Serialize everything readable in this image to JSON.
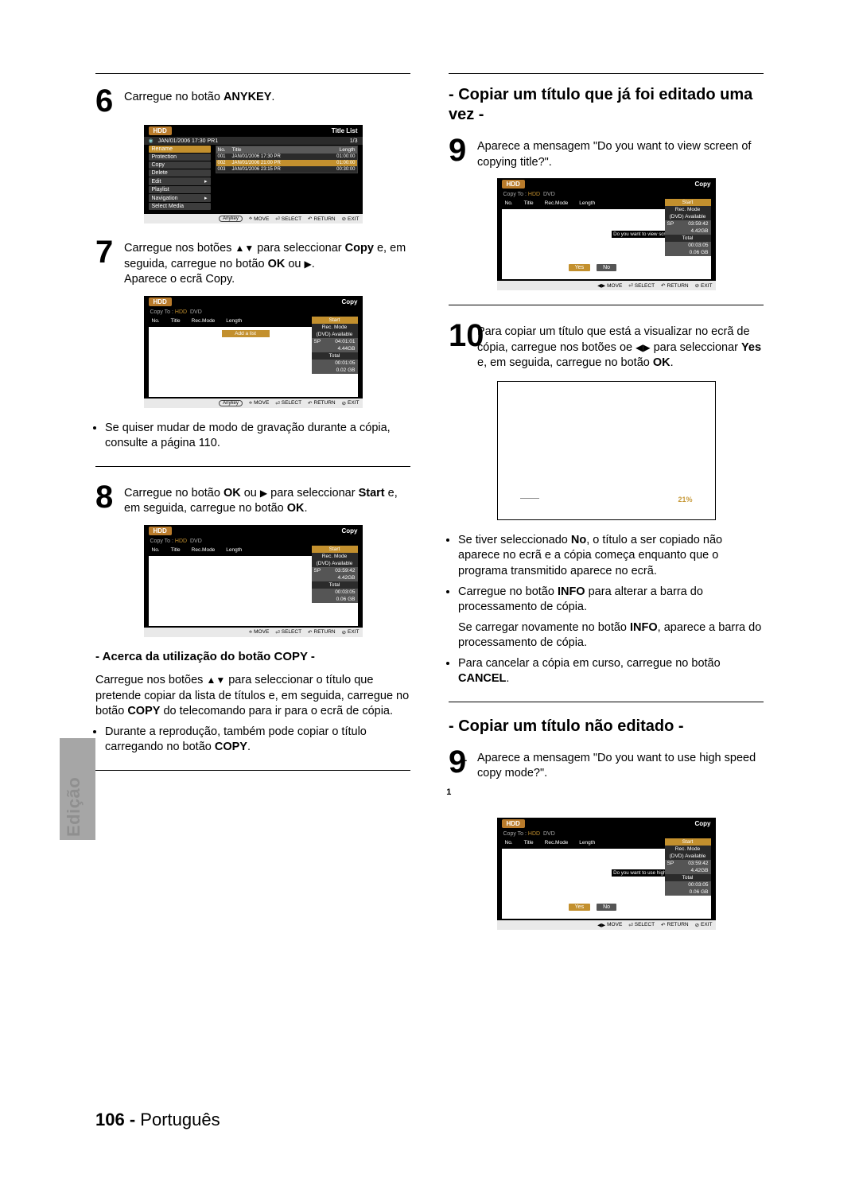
{
  "side_tab_label": "Edição",
  "footer": {
    "page_no": "106 -",
    "lang": "Português"
  },
  "left": {
    "step6": {
      "num": "6",
      "text_a": "Carregue no botão ",
      "text_b_bold": "ANYKEY",
      "text_c": "."
    },
    "step7": {
      "num": "7",
      "line1_a": "Carregue nos botões ",
      "line1_tri": "▲▼",
      "line1_b": " para seleccionar ",
      "line1_bold": "Copy",
      "line2_a": "e, em seguida, carregue no botão ",
      "line2_bold": "OK",
      "line2_b": " ou ",
      "line2_tri": "▶",
      "line2_c": ".",
      "line3": "Aparece o ecrã Copy."
    },
    "bullet_after7": "Se quiser mudar de modo de gravação durante a cópia, consulte a página 110.",
    "step8": {
      "num": "8",
      "line1_a": "Carregue no botão ",
      "line1_bold1": "OK",
      "line1_b": " ou ",
      "line1_tri": "▶",
      "line1_c": " para seleccionar",
      "line2_bold": "Start",
      "line2_a": " e, em seguida, carregue no botão ",
      "line2_bold2": "OK",
      "line2_b": "."
    },
    "sub_heading": "- Acerca da utilização do botão COPY -",
    "copy_para_a": "Carregue nos botões ",
    "copy_para_tri": "▲▼",
    "copy_para_b": " para seleccionar o título que pretende copiar da lista de títulos e, em seguida, carregue no botão ",
    "copy_para_bold": "COPY",
    "copy_para_c": " do telecomando para ir para o ecrã de cópia.",
    "copy_bullet_a": "Durante a reprodução, também pode copiar o título carregando no botão ",
    "copy_bullet_bold": "COPY",
    "copy_bullet_b": "."
  },
  "right": {
    "heading1": "- Copiar um título que já foi editado uma vez -",
    "step9": {
      "num": "9",
      "text": "Aparece a mensagem \"Do you want to view screen of copying title?\"."
    },
    "step10": {
      "num": "10",
      "line1": "Para copiar um título que está a visualizar no ecrã de cópia, carregue nos botões oe ",
      "line1_tri": "◀▶",
      "line1_b": " para seleccionar ",
      "line1_bold": "Yes",
      "line1_c": " e, em seguida, carregue no botão ",
      "line1_bold2": "OK",
      "line1_d": "."
    },
    "bullets_after10": [
      {
        "a": "Se tiver seleccionado ",
        "bold": "No",
        "b": ", o título a ser copiado não aparece no ecrã e a cópia começa enquanto que o programa transmitido aparece no ecrã."
      },
      {
        "a": "Carregue no botão ",
        "bold": "INFO",
        "b": " para alterar a barra do processamento de cópia."
      }
    ],
    "plain_after10_a": "Se carregar novamente no botão ",
    "plain_after10_bold": "INFO",
    "plain_after10_b": ", aparece a barra do processamento de cópia.",
    "bullet_cancel_a": "Para cancelar a cópia em curso, carregue no botão ",
    "bullet_cancel_bold": "CANCEL",
    "bullet_cancel_b": ".",
    "heading2": "- Copiar um título não editado -",
    "step9_1": {
      "num": "9",
      "sup": "-1",
      "text": "Aparece a mensagem \"Do you want to use high speed copy mode?\"."
    },
    "progress_pct": "21%"
  },
  "ui": {
    "hdd": "HDD",
    "title_list": "Title List",
    "copy": "Copy",
    "timestamp": "JAN/01/2006 17:30 PR1",
    "page_idx": "1/3",
    "menu": [
      "Rename",
      "Protection",
      "Copy",
      "Delete",
      "Edit",
      "Playlist",
      "Navigation",
      "Select Media"
    ],
    "col_no": "No.",
    "col_title": "Title",
    "col_rec": "Rec.Mode",
    "col_len": "Length",
    "rows": [
      {
        "no": "001",
        "title": "JAN/01/2006 17:30 PR",
        "len": "01:00:00"
      },
      {
        "no": "002",
        "title": "JAN/01/2006 21:00 PR",
        "len": "01:00:00"
      },
      {
        "no": "003",
        "title": "JAN/01/2006 23:15 PR",
        "len": "00:30:00"
      }
    ],
    "foot": {
      "anykey": "Anykey",
      "move": "MOVE",
      "select": "SELECT",
      "return": "RETURN",
      "exit": "EXIT"
    },
    "copyto_label": "Copy To :",
    "copyto_hdd": "HDD",
    "copyto_dvd": "DVD",
    "side": {
      "start": "Start",
      "recmode": "Rec. Mode",
      "dvdavail": "(DVD) Available",
      "sp": "SP",
      "sp_time_a": "04:01:01",
      "sp_gb_a": "4.44GB",
      "total": "Total",
      "total_time_a": "00:01:05",
      "total_gb_a": "0.02 GB",
      "sp_time_b": "03:59:42",
      "sp_gb_b": "4.42GB",
      "total_time_b": "00:03:05",
      "total_gb_b": "0.06 GB",
      "addalist": "Add a list"
    },
    "yes": "Yes",
    "no": "No",
    "msg_view": "Do you want to view screen of copying title?",
    "msg_hs": "Do you want to use high speed copy mode?"
  }
}
